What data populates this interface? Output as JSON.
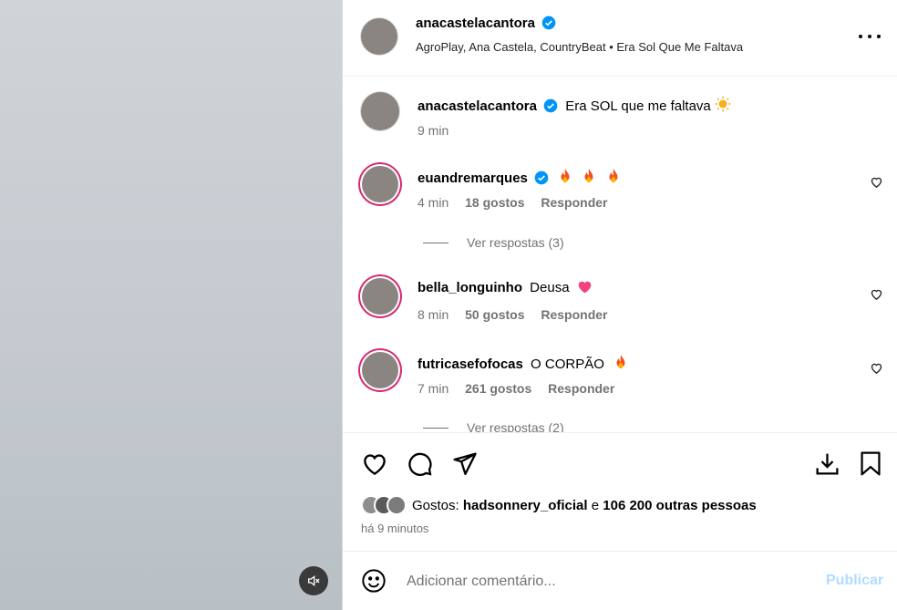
{
  "post": {
    "author": "anacastelacantora",
    "audio_line": "AgroPlay, Ana Castela, CountryBeat • Era Sol Que Me Faltava"
  },
  "caption": {
    "author": "anacastelacantora",
    "text": "Era SOL que me faltava",
    "emoji": "sun",
    "time": "9 min"
  },
  "comments": [
    {
      "user": "euandremarques",
      "verified": true,
      "text": "",
      "emoji": [
        "fire",
        "fire",
        "fire"
      ],
      "time": "4 min",
      "likes": "18 gostos",
      "reply": "Responder",
      "replies_label": "Ver respostas (3)"
    },
    {
      "user": "bella_longuinho",
      "verified": false,
      "text": "Deusa",
      "emoji": [
        "heart"
      ],
      "time": "8 min",
      "likes": "50 gostos",
      "reply": "Responder"
    },
    {
      "user": "futricasefofocas",
      "verified": false,
      "text": "O CORPÃO",
      "emoji": [
        "fire"
      ],
      "time": "7 min",
      "likes": "261 gostos",
      "reply": "Responder",
      "replies_label": "Ver respostas (2)"
    }
  ],
  "likes": {
    "prefix": "Gostos:",
    "user": "hadsonnery_oficial",
    "joiner": "e",
    "others": "106 200 outras pessoas"
  },
  "time_ago": "há 9 minutos",
  "composer": {
    "placeholder": "Adicionar comentário...",
    "publish": "Publicar"
  },
  "colors": {
    "verified": "#0095f6",
    "story_ring": "#d62976",
    "publish_disabled": "#b3dbff",
    "secondary_text": "#737373"
  },
  "icons": [
    "more-icon",
    "verified-icon",
    "heart-icon",
    "comment-icon",
    "share-icon",
    "save-icon",
    "download-icon",
    "emoji-icon",
    "mute-icon",
    "fire-emoji",
    "sun-emoji",
    "pink-heart-emoji"
  ]
}
